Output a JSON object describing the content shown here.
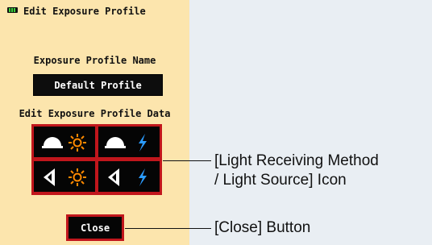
{
  "screen": {
    "title": "Edit Exposure Profile",
    "profile_name_label": "Exposure Profile Name",
    "profile_name_value": "Default Profile",
    "profile_data_label": "Edit Exposure Profile Data",
    "close_label": "Close",
    "icons": [
      {
        "name": "dome-sunlight-icon",
        "method": "dome",
        "source": "ambient"
      },
      {
        "name": "dome-flash-icon",
        "method": "dome",
        "source": "flash"
      },
      {
        "name": "flat-sunlight-icon",
        "method": "flat",
        "source": "ambient"
      },
      {
        "name": "flat-flash-icon",
        "method": "flat",
        "source": "flash"
      }
    ]
  },
  "callouts": {
    "icon_line1": "[Light Receiving Method",
    "icon_line2": "/ Light Source] Icon",
    "close_button": "[Close] Button"
  },
  "colors": {
    "screen_background": "#fce5ad",
    "accent_red": "#c1161c",
    "button_black": "#050505",
    "battery_green": "#39d23a",
    "sun_orange": "#ff8a00",
    "flash_blue": "#2b9cff"
  }
}
